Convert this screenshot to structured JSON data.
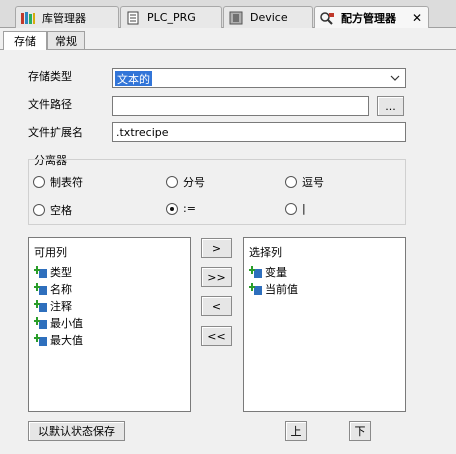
{
  "doc_tabs": [
    {
      "label": "库管理器",
      "icon": "library-icon"
    },
    {
      "label": "PLC_PRG",
      "icon": "document-icon"
    },
    {
      "label": "Device",
      "icon": "device-icon"
    },
    {
      "label": "配方管理器",
      "icon": "recipe-manager-icon",
      "active": true
    }
  ],
  "inner_tabs": [
    {
      "label": "存储",
      "active": true
    },
    {
      "label": "常规"
    }
  ],
  "form": {
    "storage_type_label": "存储类型",
    "storage_type_value": "文本的",
    "file_path_label": "文件路径",
    "file_path_value": "",
    "browse_label": "...",
    "file_ext_label": "文件扩展名",
    "file_ext_value": ".txtrecipe"
  },
  "separator": {
    "title": "分离器",
    "options": [
      {
        "label": "制表符",
        "checked": false
      },
      {
        "label": "分号",
        "checked": false
      },
      {
        "label": "逗号",
        "checked": false
      },
      {
        "label": "空格",
        "checked": false
      },
      {
        "label": ":=",
        "checked": true
      },
      {
        "label": "|",
        "checked": false
      }
    ]
  },
  "available_columns": {
    "title": "可用列",
    "items": [
      "类型",
      "名称",
      "注释",
      "最小值",
      "最大值"
    ]
  },
  "selected_columns": {
    "title": "选择列",
    "items": [
      "变量",
      "当前值"
    ]
  },
  "move_buttons": {
    "add": ">",
    "add_all": ">>",
    "remove": "<",
    "remove_all": "<<"
  },
  "bottom": {
    "save_default": "以默认状态保存",
    "up": "上",
    "down": "下"
  }
}
